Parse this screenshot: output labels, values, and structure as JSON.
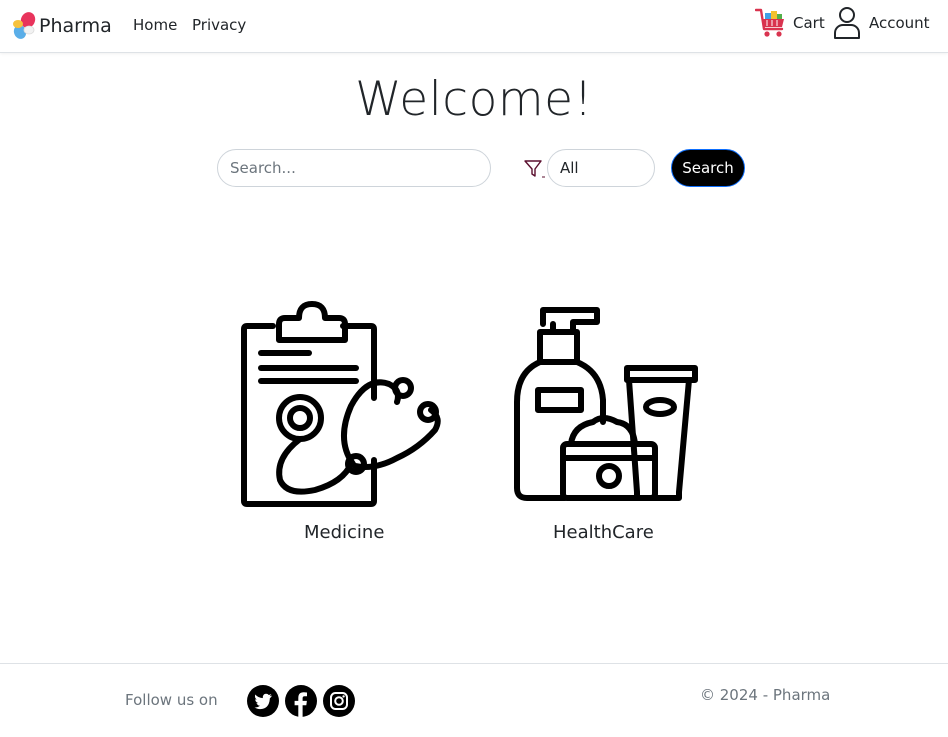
{
  "navbar": {
    "brand": "Pharma",
    "links": [
      {
        "label": "Home"
      },
      {
        "label": "Privacy"
      }
    ],
    "cart_label": "Cart",
    "account_label": "Account"
  },
  "main": {
    "title": "Welcome!",
    "search": {
      "placeholder": "Search...",
      "value": "",
      "filter_value": "All",
      "button_label": "Search"
    },
    "categories": [
      {
        "label": "Medicine",
        "icon": "clipboard-stethoscope-icon"
      },
      {
        "label": "HealthCare",
        "icon": "healthcare-products-icon"
      }
    ]
  },
  "footer": {
    "follow_label": "Follow us on",
    "social": [
      {
        "name": "twitter-icon"
      },
      {
        "name": "facebook-icon"
      },
      {
        "name": "instagram-icon"
      }
    ],
    "copyright": "© 2024 - Pharma"
  },
  "colors": {
    "accent": "#0d6efd",
    "button_bg": "#000000",
    "muted_text": "#6c757d",
    "border": "#dee2e6"
  }
}
